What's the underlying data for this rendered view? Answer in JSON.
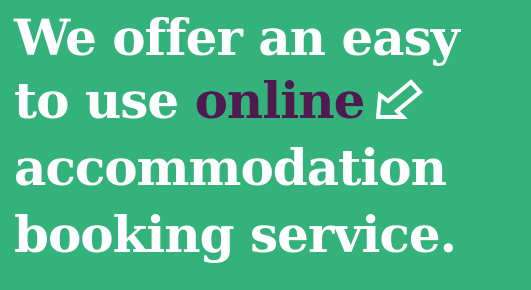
{
  "headline": {
    "line1": "We offer an easy",
    "line2_prefix": "to use ",
    "line2_accent": "online",
    "line3": "accommodation",
    "line4": "booking service."
  },
  "colors": {
    "background": "#34b27b",
    "text": "#ffffff",
    "accent": "#4f1a4f"
  },
  "icons": {
    "arrow": "arrow-down-left-outline-icon"
  }
}
